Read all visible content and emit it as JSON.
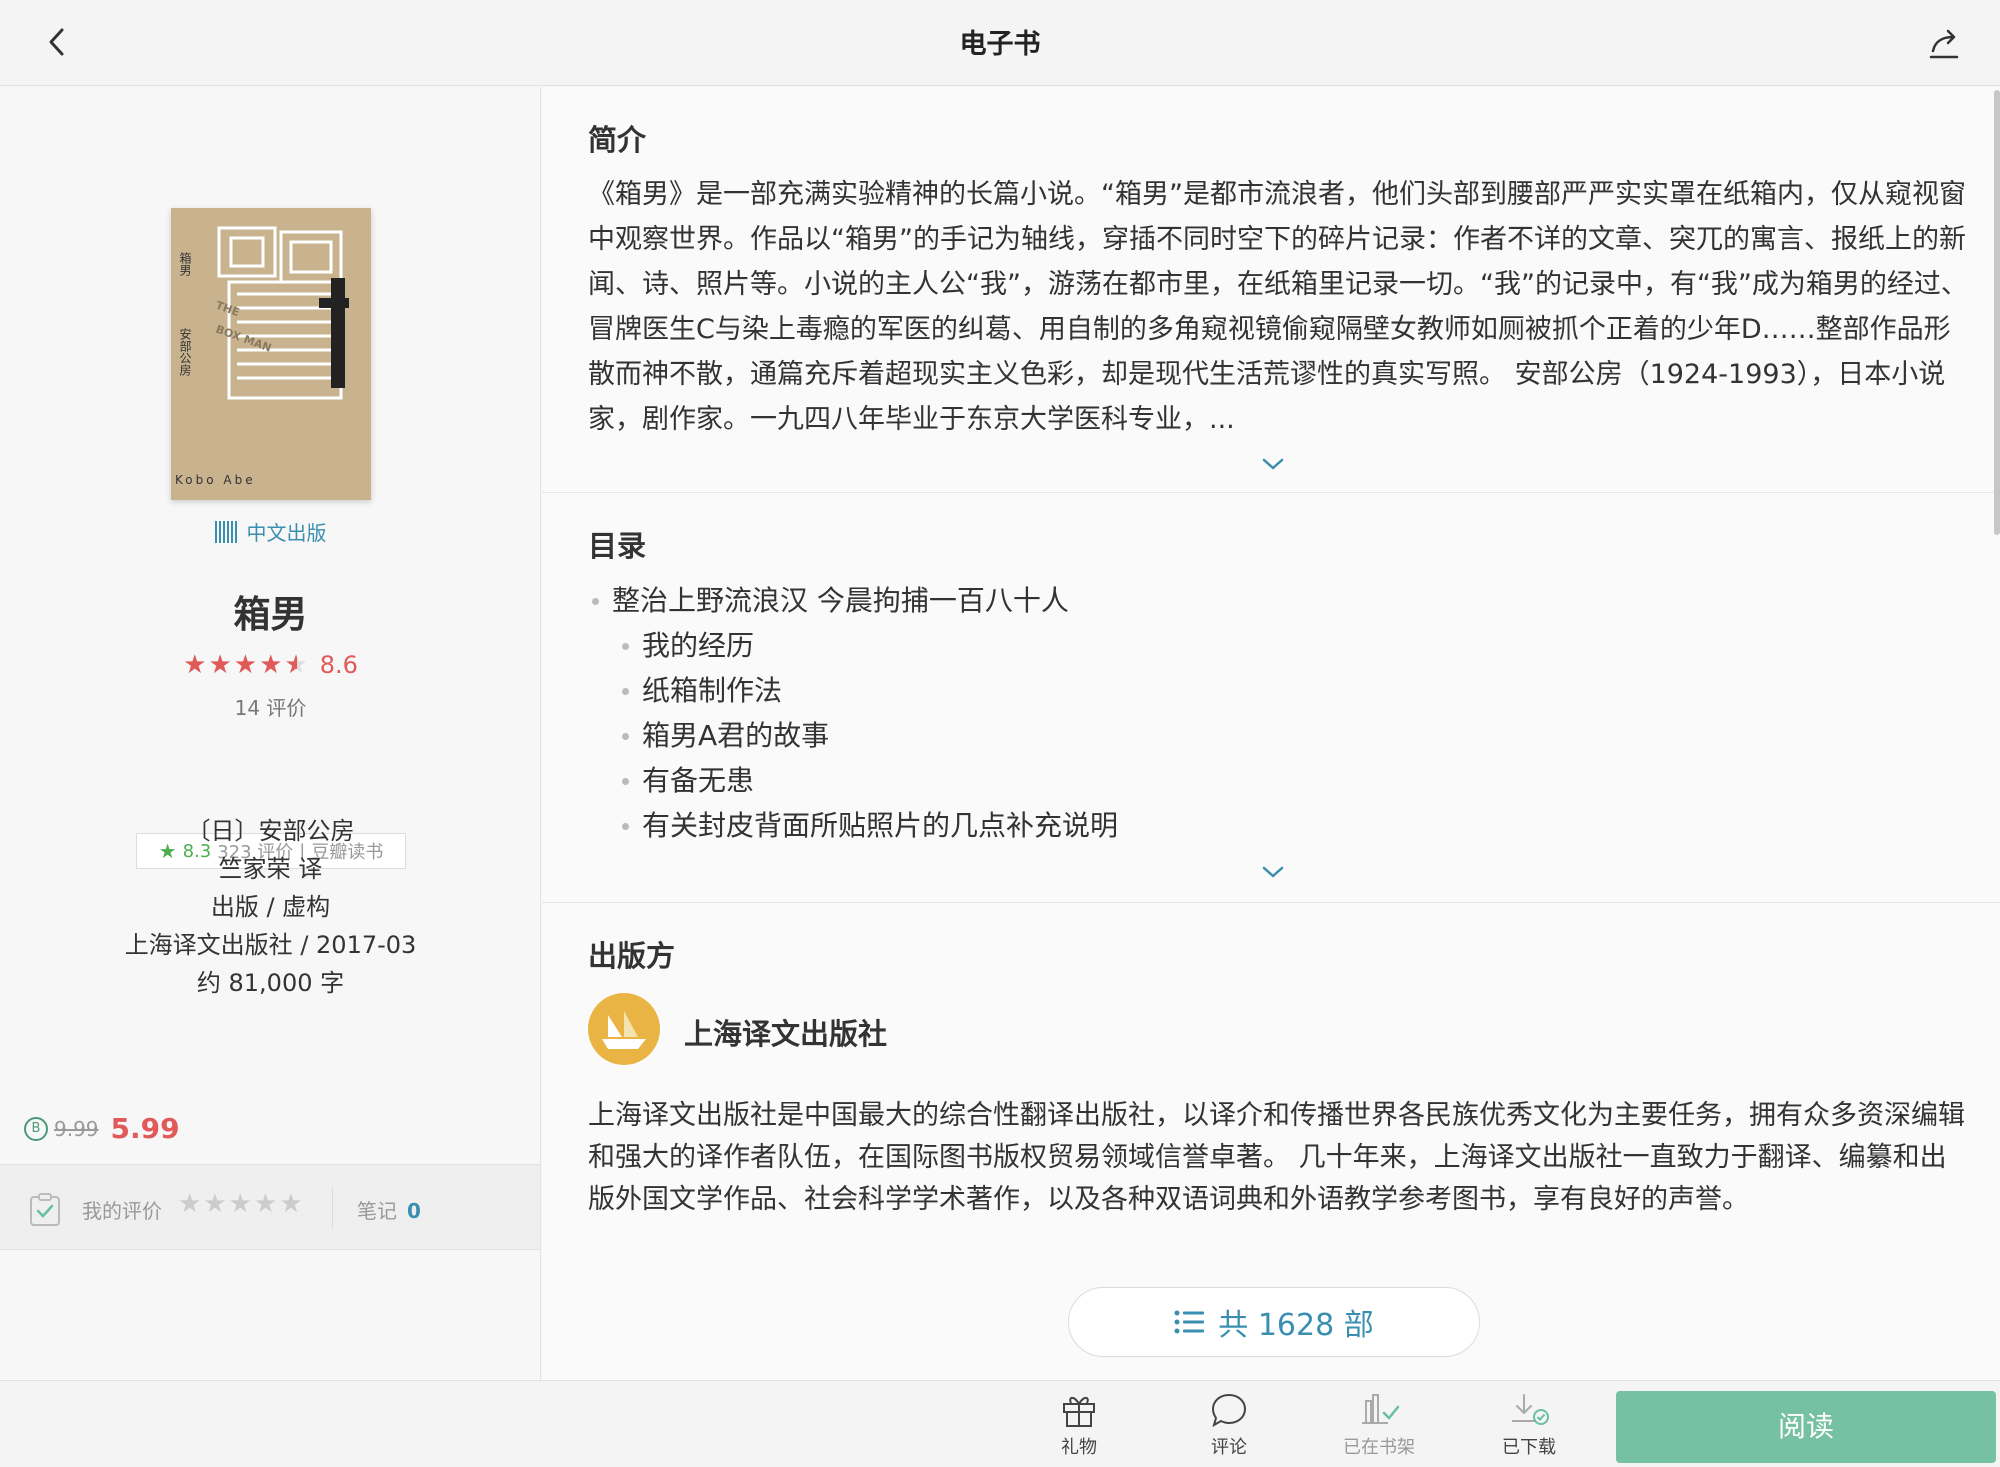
{
  "header": {
    "title": "电子书"
  },
  "book": {
    "edition": "中文出版",
    "name": "箱男",
    "rating": "8.6",
    "rating_count": "14 评价",
    "douban": {
      "score": "8.3",
      "count": "323 评价",
      "source": "豆瓣读书"
    },
    "author": "〔日〕安部公房",
    "translator": "竺家荣 译",
    "category": "出版 / 虚构",
    "publisher_date": "上海译文出版社 / 2017-03",
    "words": "约 81,000 字",
    "price_old": "9.99",
    "price_new": "5.99",
    "coin_symbol": "B",
    "my_rating_label": "我的评价",
    "notes_label": "笔记",
    "notes_count": "0"
  },
  "cover": {
    "vertical_title": "箱男",
    "vertical_author": "安部公房",
    "en_title1": "THE",
    "en_title2": "BOX MAN",
    "romaji": "Kobo Abe"
  },
  "intro": {
    "heading": "简介",
    "text": "《箱男》是一部充满实验精神的长篇小说。“箱男”是都市流浪者，他们头部到腰部严严实实罩在纸箱内，仅从窥视窗中观察世界。作品以“箱男”的手记为轴线，穿插不同时空下的碎片记录：作者不详的文章、突兀的寓言、报纸上的新闻、诗、照片等。小说的主人公“我”，游荡在都市里，在纸箱里记录一切。“我”的记录中，有“我”成为箱男的经过、冒牌医生C与染上毒瘾的军医的纠葛、用自制的多角窥视镜偷窥隔壁女教师如厕被抓个正着的少年D……整部作品形散而神不散，通篇充斥着超现实主义色彩，却是现代生活荒谬性的真实写照。 安部公房（1924-1993），日本小说家，剧作家。一九四八年毕业于东京大学医科专业，..."
  },
  "toc": {
    "heading": "目录",
    "items": [
      {
        "label": "整治上野流浪汉 今晨拘捕一百八十人",
        "level": 1
      },
      {
        "label": "我的经历",
        "level": 2
      },
      {
        "label": "纸箱制作法",
        "level": 2
      },
      {
        "label": "箱男A君的故事",
        "level": 2
      },
      {
        "label": "有备无患",
        "level": 2
      },
      {
        "label": "有关封皮背面所贴照片的几点补充说明",
        "level": 2
      }
    ]
  },
  "publisher": {
    "heading": "出版方",
    "name": "上海译文出版社",
    "desc": "上海译文出版社是中国最大的综合性翻译出版社，以译介和传播世界各民族优秀文化为主要任务，拥有众多资深编辑和强大的译作者队伍，在国际图书版权贸易领域信誉卓著。 几十年来，上海译文出版社一直致力于翻译、编纂和出版外国文学作品、社会科学学术著作，以及各种双语词典和外语教学参考图书，享有良好的声誉。",
    "count_label": "共 1628 部"
  },
  "bottombar": {
    "gift": "礼物",
    "comment": "评论",
    "shelf": "已在书架",
    "downloaded": "已下载",
    "read": "阅读"
  },
  "colors": {
    "accent": "#3a8fb0",
    "price": "#e05a5a",
    "read_button": "#76c0a3",
    "douban_green": "#4caf50"
  }
}
